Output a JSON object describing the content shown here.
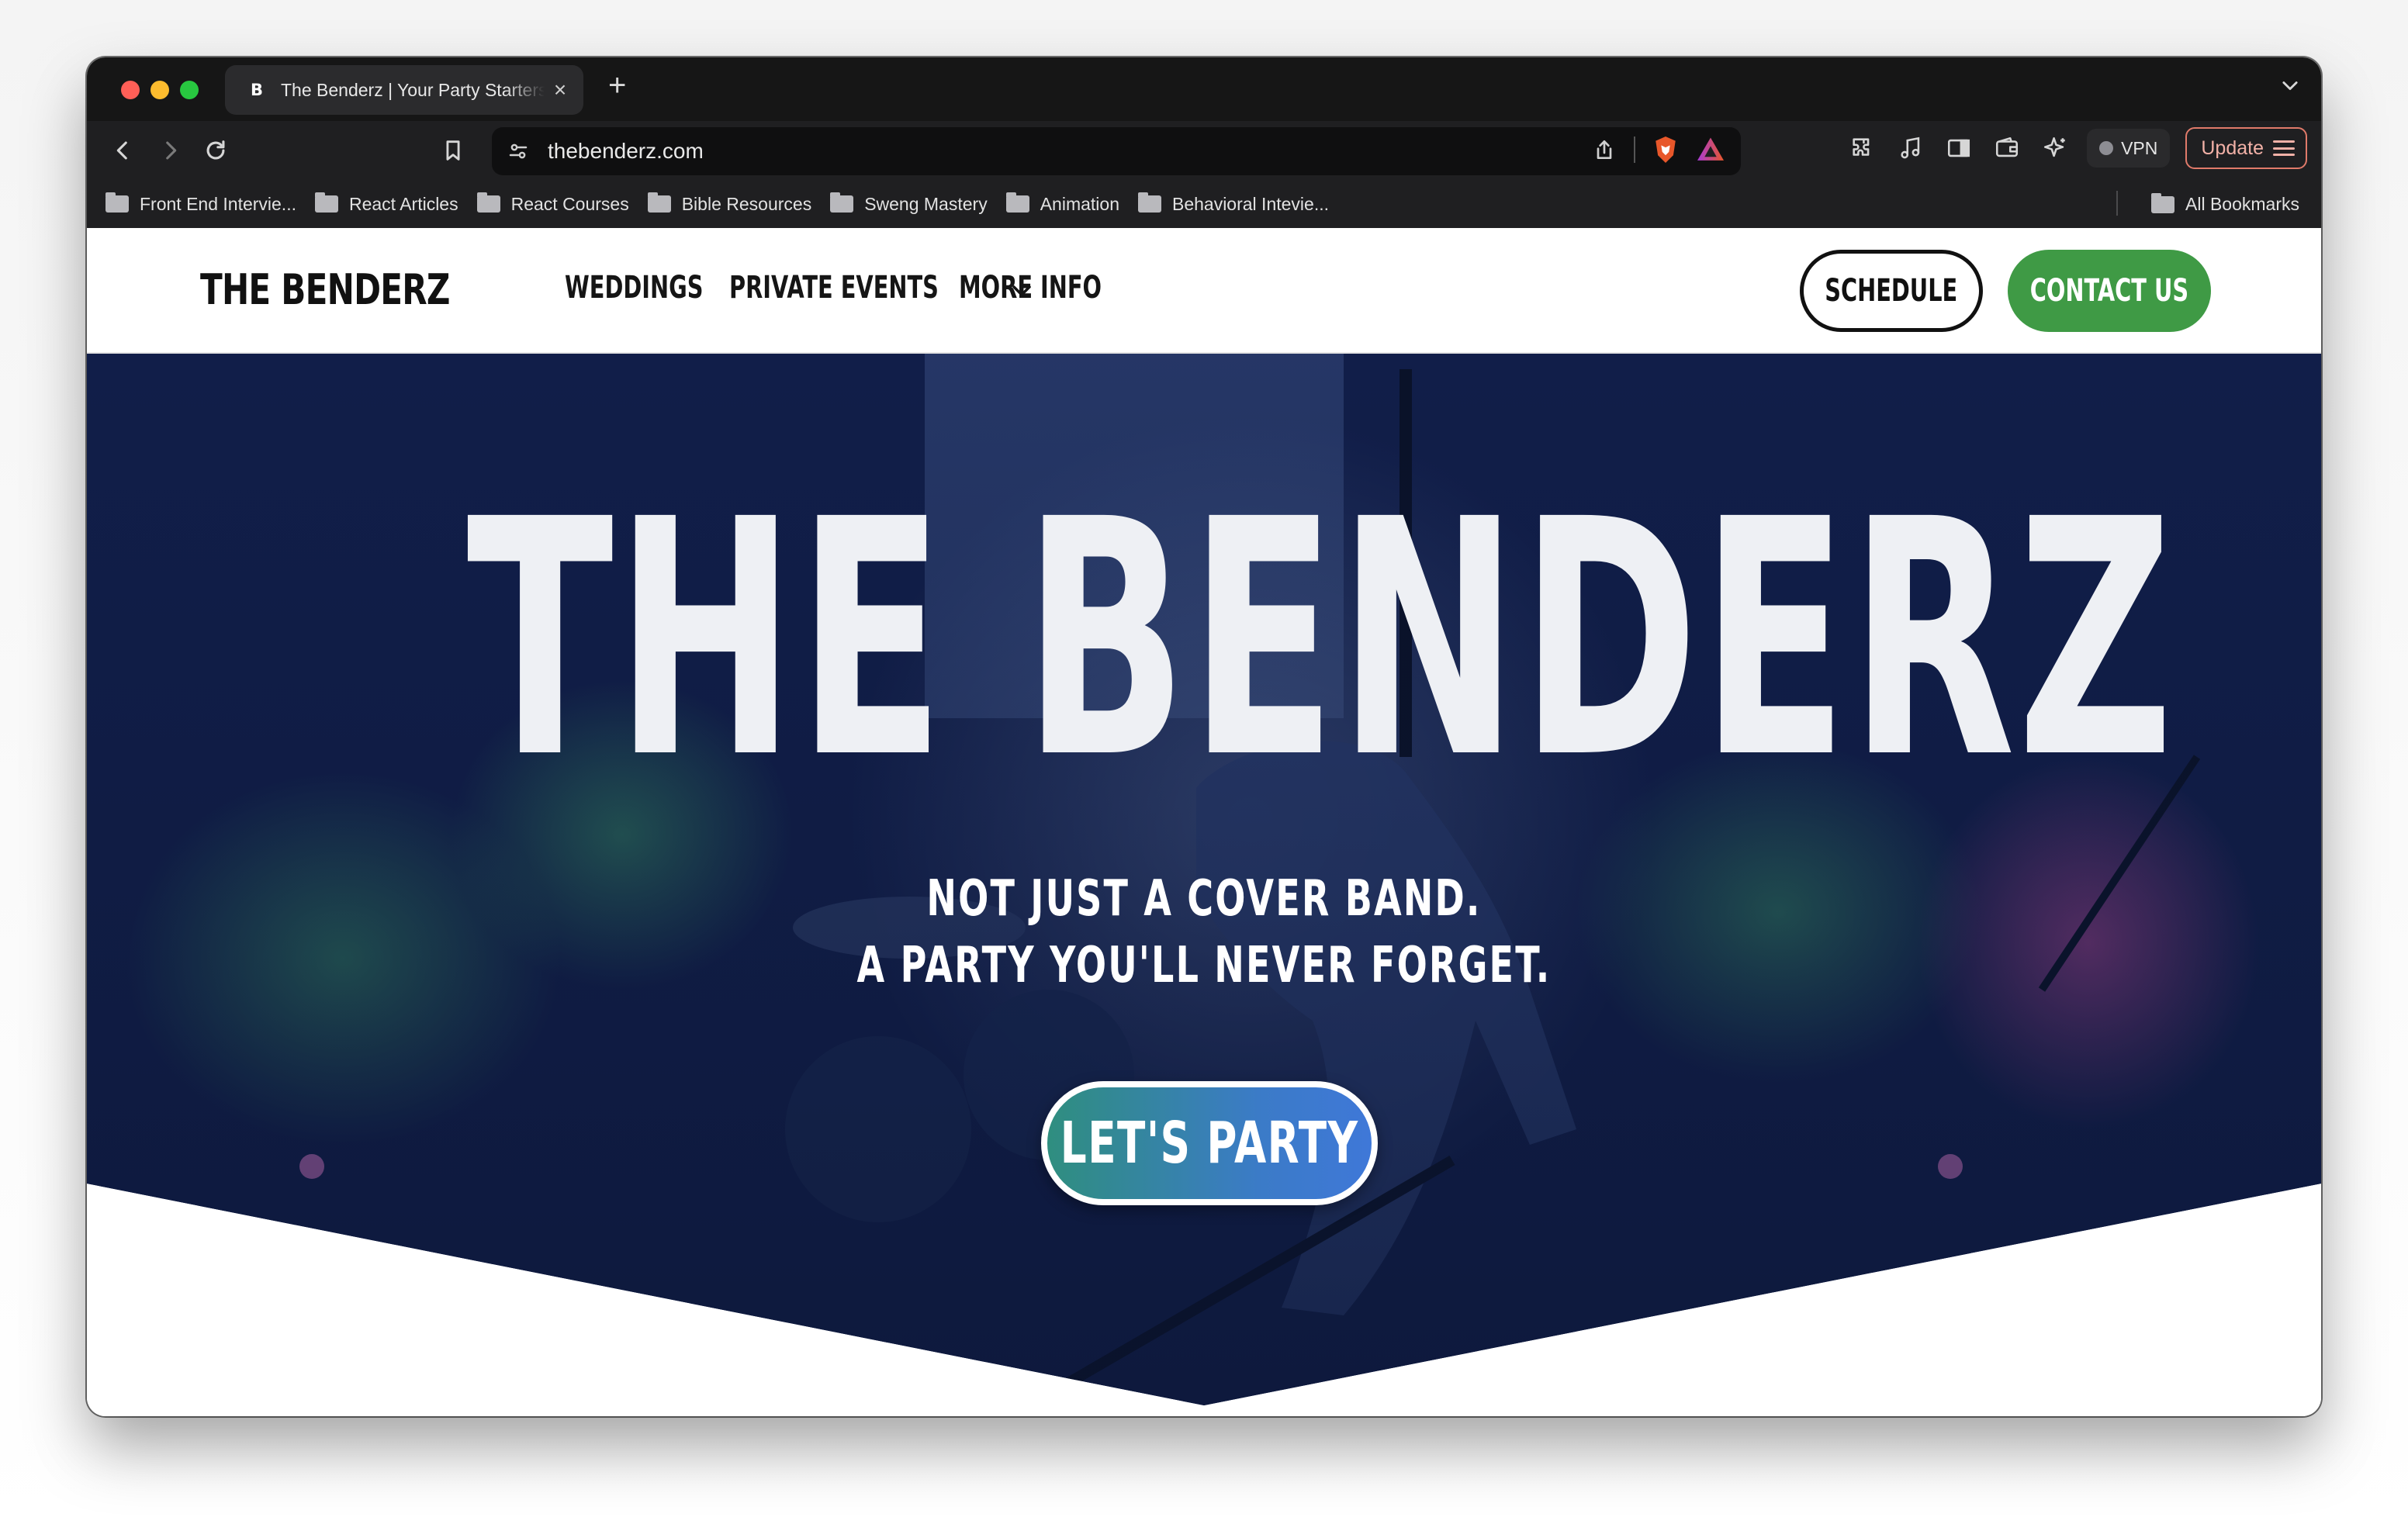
{
  "browser": {
    "tab": {
      "favicon": "B",
      "title": "The Benderz | Your Party Starters",
      "close": "×"
    },
    "new_tab": "+",
    "address": "thebenderz.com",
    "vpn_label": "VPN",
    "update_label": "Update",
    "bookmarks": [
      {
        "label": "Front End Intervie..."
      },
      {
        "label": "React Articles"
      },
      {
        "label": "React Courses"
      },
      {
        "label": "Bible Resources"
      },
      {
        "label": "Sweng Mastery"
      },
      {
        "label": "Animation"
      },
      {
        "label": "Behavioral Intevie..."
      }
    ],
    "all_bookmarks": "All Bookmarks",
    "colors": {
      "tabbar": "#161616",
      "toolbar": "#1f1f21",
      "update_accent": "#e07a6a"
    }
  },
  "site": {
    "brand": "THE BENDERZ",
    "nav": [
      {
        "label": "WEDDINGS"
      },
      {
        "label": "PRIVATE EVENTS"
      },
      {
        "label": "MORE INFO"
      }
    ],
    "schedule_label": "SCHEDULE",
    "contact_label": "CONTACT US",
    "hero": {
      "title": "THE BENDERZ",
      "subtitle_line1": "NOT JUST A COVER BAND.",
      "subtitle_line2": "A PARTY YOU'LL NEVER FORGET.",
      "cta_label": "LET'S PARTY"
    },
    "colors": {
      "contact_green": "#3f9a45",
      "hero_navy": "#0e1a42",
      "cta_teal": "#2f8e7f",
      "cta_blue": "#3f78d8"
    }
  }
}
